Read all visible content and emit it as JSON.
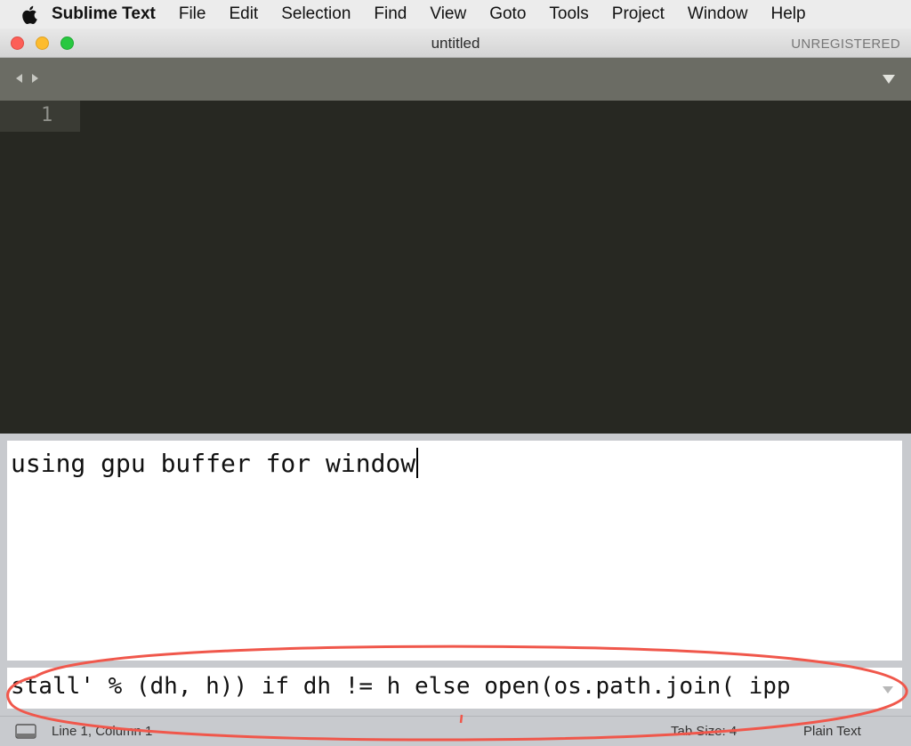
{
  "menubar": {
    "app_name": "Sublime Text",
    "items": [
      "File",
      "Edit",
      "Selection",
      "Find",
      "View",
      "Goto",
      "Tools",
      "Project",
      "Window",
      "Help"
    ]
  },
  "window": {
    "title": "untitled",
    "registration": "UNREGISTERED"
  },
  "editor": {
    "line_numbers": [
      "1"
    ]
  },
  "console": {
    "output": "using gpu buffer for window",
    "input_value": "stall' % (dh, h)) if dh != h else open(os.path.join( ipp"
  },
  "statusbar": {
    "position": "Line 1, Column 1",
    "tab_size": "Tab Size: 4",
    "syntax": "Plain Text"
  },
  "colors": {
    "editor_bg": "#272822",
    "tabbar_bg": "#6b6c64",
    "panel_bg": "#c8cace",
    "annotation": "#f0574b"
  }
}
